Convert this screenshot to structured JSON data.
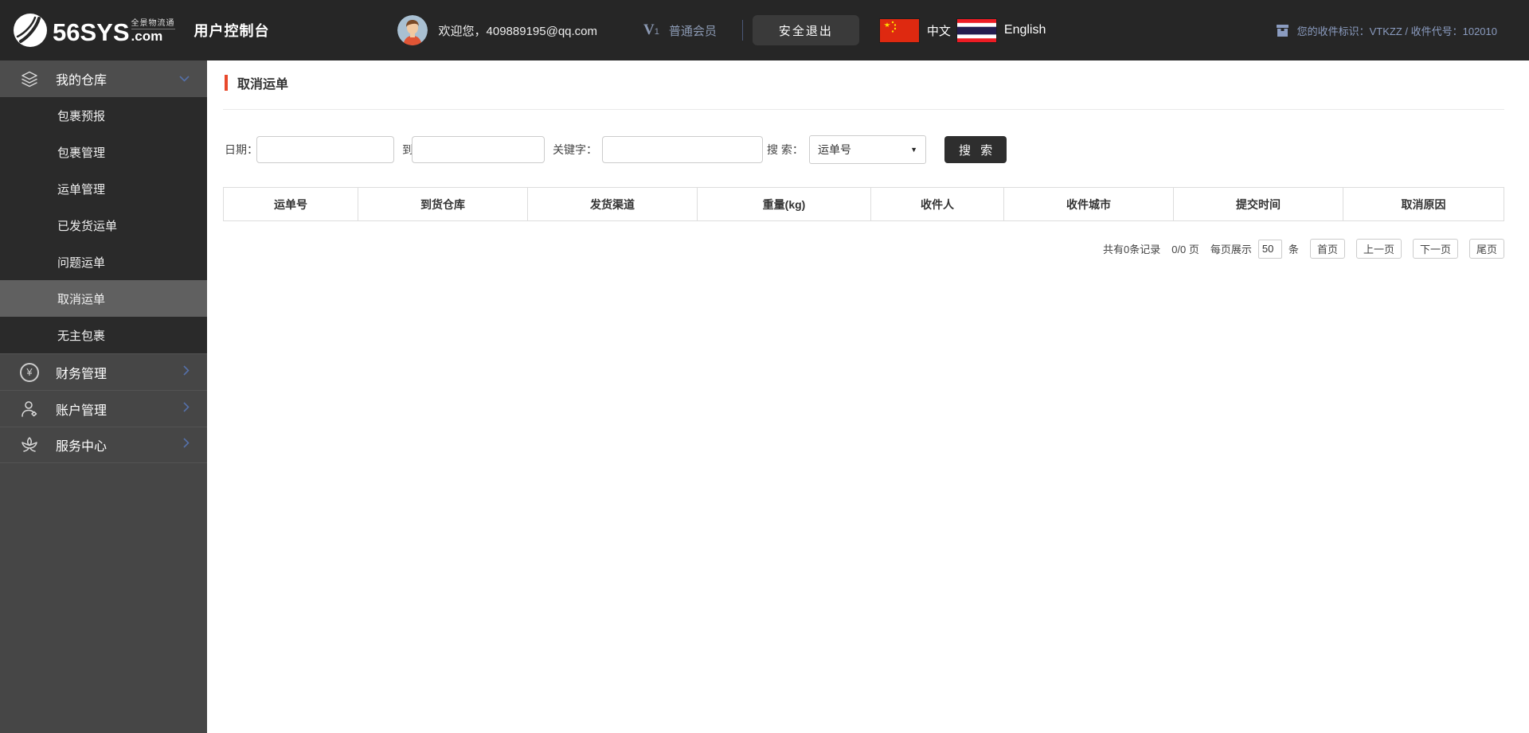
{
  "header": {
    "logo_main": "56SYS",
    "logo_cn": "全景物流通",
    "logo_com": ".com",
    "console_title": "用户控制台",
    "welcome": "欢迎您，409889195@qq.com",
    "member_badge": {
      "v": "V",
      "sub": "1"
    },
    "member_level": "普通会员",
    "logout_label": "安全退出",
    "lang_zh": "中文",
    "lang_en": "English",
    "receiver_info": "您的收件标识：VTKZZ / 收件代号：102010"
  },
  "sidebar": {
    "my_warehouse": {
      "label": "我的仓库"
    },
    "sub_items": [
      {
        "label": "包裹预报"
      },
      {
        "label": "包裹管理"
      },
      {
        "label": "运单管理"
      },
      {
        "label": "已发货运单"
      },
      {
        "label": "问题运单"
      },
      {
        "label": "取消运单",
        "active": true
      },
      {
        "label": "无主包裹"
      }
    ],
    "bottom_items": [
      {
        "label": "财务管理"
      },
      {
        "label": "账户管理"
      },
      {
        "label": "服务中心"
      }
    ]
  },
  "main": {
    "page_title": "取消运单",
    "filter": {
      "date_label": "日期：",
      "to_label": "到",
      "keyword_label": "关键字：",
      "search_label": "搜 索：",
      "search_select_value": "运单号",
      "select_caret": "▼",
      "search_button": "搜 索",
      "date_from_value": "",
      "date_to_value": "",
      "keyword_value": ""
    },
    "table": {
      "columns": [
        "运单号",
        "到货仓库",
        "发货渠道",
        "重量(kg)",
        "收件人",
        "收件城市",
        "提交时间",
        "取消原因"
      ]
    },
    "pagination": {
      "total_text": "共有0条记录",
      "page_text": "0/0 页",
      "per_page_label": "每页展示",
      "per_page_value": "50",
      "unit_label": "条",
      "first_label": "首页",
      "prev_label": "上一页",
      "next_label": "下一页",
      "last_label": "尾页"
    }
  },
  "colors": {
    "accent": "#e8492c",
    "header_bg": "#262626",
    "sidebar_bg": "#464646",
    "submenu_bg": "#2a2a2a",
    "active_item_bg": "#606060",
    "muted_slate": "#8b99b3",
    "dark_button": "#2e2e2e"
  }
}
